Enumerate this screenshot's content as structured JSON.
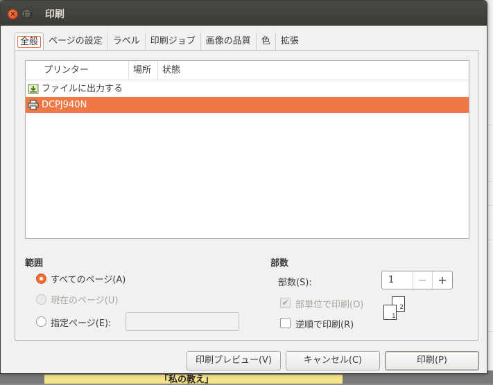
{
  "window": {
    "title": "印刷"
  },
  "tabs": [
    "全般",
    "ページの設定",
    "ラベル",
    "印刷ジョブ",
    "画像の品質",
    "色",
    "拡張"
  ],
  "printer_list": {
    "columns": [
      "プリンター",
      "場所",
      "状態"
    ],
    "rows": [
      {
        "name": "ファイルに出力する",
        "icon": "file-download-icon",
        "selected": false
      },
      {
        "name": "DCPJ940N",
        "icon": "printer-icon",
        "selected": true
      }
    ]
  },
  "range": {
    "title": "範囲",
    "all_pages": "すべてのページ(A)",
    "current_page": "現在のページ(U)",
    "specified_pages": "指定ページ(E):",
    "specified_value": ""
  },
  "copies": {
    "title": "部数",
    "label": "部数(S):",
    "value": "1",
    "collate": "部単位で印刷(O)",
    "collate_checked": true,
    "reverse": "逆順で印刷(R)",
    "reverse_checked": false
  },
  "buttons": {
    "preview": "印刷プレビュー(V)",
    "cancel": "キャンセル(C)",
    "print": "印刷(P)"
  },
  "colors": {
    "accent": "#f07746",
    "titlebar": "#3c3b37"
  },
  "background": {
    "document_text": "「私の教え」"
  }
}
